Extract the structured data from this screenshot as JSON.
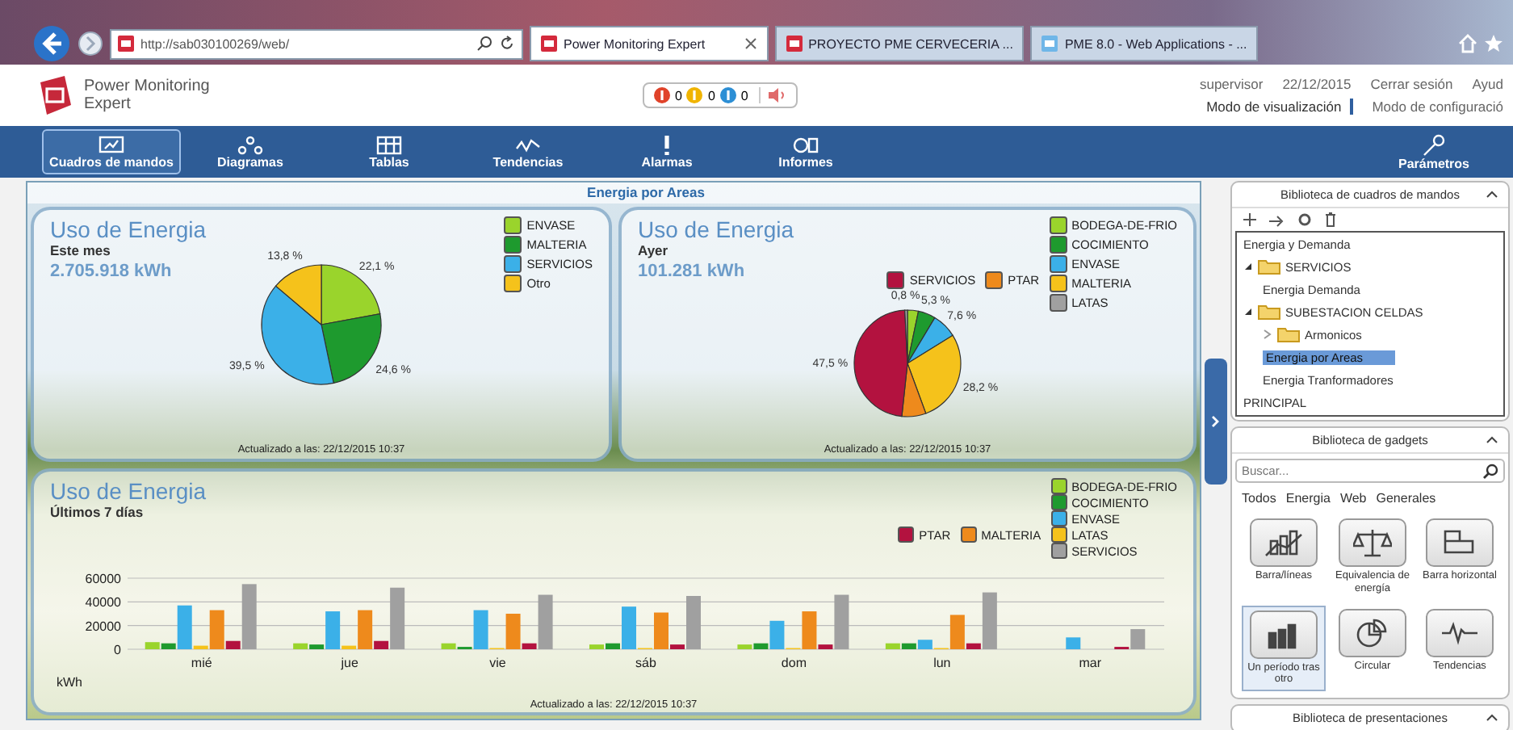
{
  "browser": {
    "address": "http://sab030100269/web/",
    "tabs": [
      {
        "title": "Power Monitoring Expert",
        "selected": true
      },
      {
        "title": "PROYECTO PME CERVECERIA ...",
        "selected": false
      },
      {
        "title": "PME 8.0 - Web Applications - ...",
        "selected": false
      }
    ]
  },
  "app": {
    "name": "Power Monitoring Expert",
    "alarm_counts": [
      "0",
      "0",
      "0"
    ],
    "user": "supervisor",
    "date": "22/12/2015",
    "links": [
      "Cerrar sesión",
      "Ayud"
    ],
    "modes": [
      {
        "label": "Modo de visualización",
        "selected": true
      },
      {
        "label": "Modo de configuració",
        "selected": false
      }
    ]
  },
  "nav": {
    "items": [
      {
        "label": "Cuadros de mandos",
        "selected": true
      },
      {
        "label": "Diagramas",
        "selected": false
      },
      {
        "label": "Tablas",
        "selected": false
      },
      {
        "label": "Tendencias",
        "selected": false
      },
      {
        "label": "Alarmas",
        "selected": false
      },
      {
        "label": "Informes",
        "selected": false
      }
    ],
    "settings": "Parámetros"
  },
  "dashboard": {
    "title": "Energia por Areas",
    "cards": [
      {
        "kind": "pie",
        "title": "Uso de Energia",
        "period": "Este mes",
        "total": "2.705.918 kWh",
        "updated": "Actualizado a las: 22/12/2015 10:37",
        "chart_data": {
          "type": "pie",
          "categories": [
            "ENVASE",
            "MALTERIA",
            "SERVICIOS",
            "Otro"
          ],
          "values": [
            22.1,
            24.6,
            39.5,
            13.8
          ],
          "colors": [
            "#9ad42c",
            "#1e9a2e",
            "#3bb0e8",
            "#f5c21b"
          ],
          "value_labels": [
            "22,1 %",
            "24,6 %",
            "39,5 %",
            "13,8 %"
          ]
        }
      },
      {
        "kind": "pie",
        "title": "Uso de Energia",
        "period": "Ayer",
        "total": "101.281 kWh",
        "updated": "Actualizado a las: 22/12/2015 10:37",
        "chart_data": {
          "type": "pie",
          "categories": [
            "BODEGA-DE-FRIO",
            "COCIMIENTO",
            "ENVASE",
            "MALTERIA",
            "PTAR",
            "SERVICIOS",
            "LATAS"
          ],
          "values": [
            3.3,
            5.3,
            7.6,
            28.2,
            7.3,
            47.5,
            0.8
          ],
          "colors": [
            "#9ad42c",
            "#1e9a2e",
            "#3bb0e8",
            "#f5c21b",
            "#ee8a1c",
            "#b3123f",
            "#a0a0a0"
          ],
          "value_labels": [
            null,
            "5,3 %",
            "7,6 %",
            "28,2 %",
            null,
            "47,5 %",
            "0,8 %"
          ]
        }
      },
      {
        "kind": "bar",
        "title": "Uso de Energia",
        "period": "Últimos 7 días",
        "updated": "Actualizado a las: 22/12/2015 10:37",
        "chart_data": {
          "type": "bar",
          "ylabel": "kWh",
          "categories": [
            "mié",
            "jue",
            "vie",
            "sáb",
            "dom",
            "lun",
            "mar"
          ],
          "ylim": [
            0,
            60000
          ],
          "yticks": [
            0,
            20000,
            40000,
            60000
          ],
          "series": [
            {
              "name": "BODEGA-DE-FRIO",
              "color": "#9ad42c",
              "values": [
                6000,
                5000,
                5000,
                4000,
                4000,
                5000,
                0
              ]
            },
            {
              "name": "COCIMIENTO",
              "color": "#1e9a2e",
              "values": [
                5000,
                4000,
                2000,
                5000,
                5000,
                5000,
                0
              ]
            },
            {
              "name": "ENVASE",
              "color": "#3bb0e8",
              "values": [
                37000,
                32000,
                33000,
                36000,
                24000,
                8000,
                10000
              ]
            },
            {
              "name": "LATAS",
              "color": "#f5c21b",
              "values": [
                3000,
                3000,
                1000,
                1000,
                1000,
                1000,
                0
              ]
            },
            {
              "name": "MALTERIA",
              "color": "#ee8a1c",
              "values": [
                33000,
                33000,
                30000,
                31000,
                32000,
                29000,
                0
              ]
            },
            {
              "name": "PTAR",
              "color": "#b3123f",
              "values": [
                7000,
                7000,
                5000,
                4000,
                4000,
                5000,
                2000
              ]
            },
            {
              "name": "SERVICIOS",
              "color": "#a0a0a0",
              "values": [
                55000,
                52000,
                46000,
                45000,
                46000,
                48000,
                17000
              ]
            }
          ]
        }
      }
    ]
  },
  "sidebar": {
    "dashboards": {
      "title": "Biblioteca de cuadros de mandos",
      "tree": [
        {
          "label": "Energia y Demanda",
          "kind": "item",
          "selected": false
        },
        {
          "label": "SERVICIOS",
          "kind": "folder",
          "expanded": true,
          "selected": false,
          "children": [
            {
              "label": "Energia Demanda",
              "kind": "item",
              "selected": false
            }
          ]
        },
        {
          "label": "SUBESTACION CELDAS",
          "kind": "folder",
          "expanded": true,
          "selected": false,
          "children": [
            {
              "label": "Armonicos",
              "kind": "folder",
              "expanded": false,
              "selected": false
            },
            {
              "label": "Energia por Areas",
              "kind": "item",
              "selected": true
            },
            {
              "label": "Energia Tranformadores",
              "kind": "item",
              "selected": false
            }
          ]
        },
        {
          "label": "PRINCIPAL",
          "kind": "item",
          "selected": false
        }
      ]
    },
    "gadgets": {
      "title": "Biblioteca de gadgets",
      "search": {
        "placeholder": "Buscar..."
      },
      "filters": [
        "Todos",
        "Energia",
        "Web",
        "Generales"
      ],
      "items": [
        {
          "label": "Barra/líneas",
          "selected": false
        },
        {
          "label": "Equivalencia de energía",
          "selected": false
        },
        {
          "label": "Barra horizontal",
          "selected": false
        },
        {
          "label": "Un período tras otro",
          "selected": true
        },
        {
          "label": "Circular",
          "selected": false
        },
        {
          "label": "Tendencias",
          "selected": false
        }
      ]
    },
    "presentations": {
      "title": "Biblioteca de presentaciones"
    }
  }
}
